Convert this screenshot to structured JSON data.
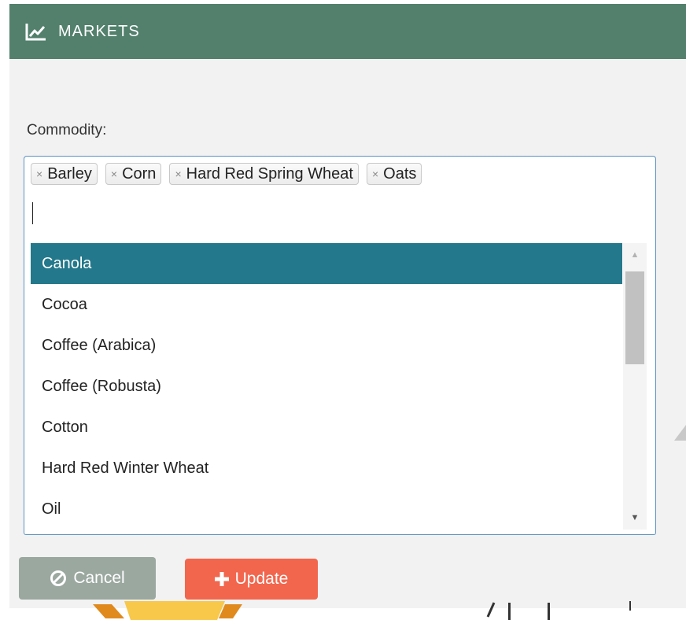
{
  "header": {
    "title": "MARKETS",
    "icon": "line-chart-icon",
    "color": "#52806c"
  },
  "commodity": {
    "label": "Commodity:",
    "selected": [
      {
        "label": "Barley",
        "remove_glyph": "×"
      },
      {
        "label": "Corn",
        "remove_glyph": "×"
      },
      {
        "label": "Hard Red Spring Wheat",
        "remove_glyph": "×"
      },
      {
        "label": "Oats",
        "remove_glyph": "×"
      }
    ],
    "input_value": "",
    "options": [
      {
        "label": "Canola",
        "highlighted": true
      },
      {
        "label": "Cocoa",
        "highlighted": false
      },
      {
        "label": "Coffee (Arabica)",
        "highlighted": false
      },
      {
        "label": "Coffee (Robusta)",
        "highlighted": false
      },
      {
        "label": "Cotton",
        "highlighted": false
      },
      {
        "label": "Hard Red Winter Wheat",
        "highlighted": false
      },
      {
        "label": "Oil",
        "highlighted": false
      }
    ],
    "highlight_color": "#24788b",
    "scroll_up_glyph": "▲",
    "scroll_down_glyph": "▼"
  },
  "buttons": {
    "cancel": {
      "label": "Cancel",
      "icon": "ban-icon",
      "color": "#9ba8a0"
    },
    "update": {
      "label": "Update",
      "icon": "plus-icon",
      "color": "#f2664d"
    }
  }
}
